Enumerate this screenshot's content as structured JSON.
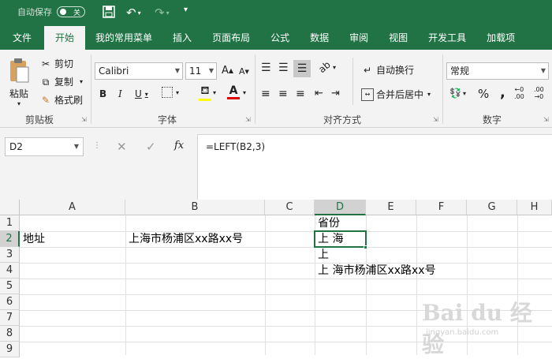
{
  "qat": {
    "autosave_label": "自动保存",
    "autosave_state": "关"
  },
  "tabs": [
    "文件",
    "开始",
    "我的常用菜单",
    "插入",
    "页面布局",
    "公式",
    "数据",
    "审阅",
    "视图",
    "开发工具",
    "加载项"
  ],
  "active_tab": "开始",
  "clipboard": {
    "paste": "粘贴",
    "cut": "剪切",
    "copy": "复制",
    "format_painter": "格式刷",
    "group": "剪贴板"
  },
  "font": {
    "name": "Calibri",
    "size": "11",
    "grow": "A",
    "shrink": "A",
    "bold": "B",
    "italic": "I",
    "underline": "U",
    "group": "字体"
  },
  "alignment": {
    "wrap": "自动换行",
    "merge": "合并后居中",
    "group": "对齐方式"
  },
  "number": {
    "format": "常规",
    "percent": "%",
    "comma": ",",
    "group": "数字"
  },
  "formula_bar": {
    "name_box": "D2",
    "cancel": "✕",
    "enter": "✓",
    "fx": "fx",
    "formula": "=LEFT(B2,3)"
  },
  "columns": [
    "A",
    "B",
    "C",
    "D",
    "E",
    "F",
    "G",
    "H"
  ],
  "rows": [
    "1",
    "2",
    "3",
    "4",
    "5",
    "6",
    "7",
    "8",
    "9"
  ],
  "cells": {
    "D1": "省份",
    "A2": "地址",
    "B2": "上海市杨浦区xx路xx号",
    "D2": "上 海",
    "D3": "上",
    "D4": "上 海市杨浦区xx路xx号"
  },
  "watermark": {
    "main": "Bai du 经验",
    "sub": "jingyan.baidu.com"
  },
  "colors": {
    "brand": "#217346"
  }
}
